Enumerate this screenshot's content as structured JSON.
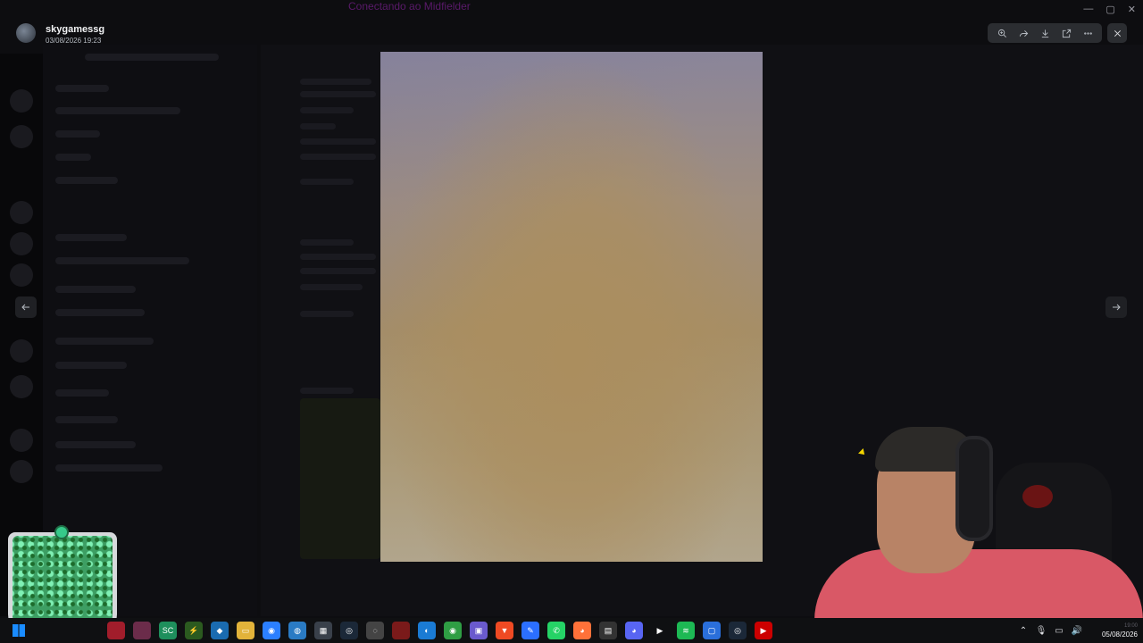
{
  "window": {
    "title": "Conectando ao Midfielder",
    "title_color": "#5a1a6a"
  },
  "viewer": {
    "username": "skygamessg",
    "date": "03/08/2026 19:23",
    "toolbar_icons": [
      "zoom-in-icon",
      "forward-icon",
      "download-icon",
      "open-external-icon",
      "more-icon"
    ],
    "close_icon": "close-icon",
    "prev_icon": "arrow-left-icon",
    "next_icon": "arrow-right-icon"
  },
  "taskbar": {
    "apps": [
      {
        "name": "media-app-icon",
        "color": "#a11d2b",
        "glyph": ""
      },
      {
        "name": "game-app-icon",
        "color": "#6b2c4a",
        "glyph": ""
      },
      {
        "name": "sc-app-icon",
        "color": "#1e8f5c",
        "glyph": "SC"
      },
      {
        "name": "nvidia-app-icon",
        "color": "#2b5a1f",
        "glyph": "⚡"
      },
      {
        "name": "vscode-app-icon",
        "color": "#1a6bb0",
        "glyph": "◆"
      },
      {
        "name": "explorer-app-icon",
        "color": "#e2b33a",
        "glyph": "▭"
      },
      {
        "name": "chat-app-icon",
        "color": "#2b7fff",
        "glyph": "◉"
      },
      {
        "name": "globe-app-icon",
        "color": "#2a7bc4",
        "glyph": "◍"
      },
      {
        "name": "store-app-icon",
        "color": "#39404a",
        "glyph": "▦"
      },
      {
        "name": "steam-app-icon",
        "color": "#1b2838",
        "glyph": "◎"
      },
      {
        "name": "chrome-alt-app-icon",
        "color": "#444",
        "glyph": "◌"
      },
      {
        "name": "red-app-icon",
        "color": "#7a1a1a",
        "glyph": ""
      },
      {
        "name": "edge-app-icon",
        "color": "#1a7bd4",
        "glyph": "◐"
      },
      {
        "name": "chrome-app-icon",
        "color": "#2f9e44",
        "glyph": "◉"
      },
      {
        "name": "grid-app-icon",
        "color": "#6a5acd",
        "glyph": "▣"
      },
      {
        "name": "brave-app-icon",
        "color": "#ef4a23",
        "glyph": "▼"
      },
      {
        "name": "pen-app-icon",
        "color": "#2b6fff",
        "glyph": "✎"
      },
      {
        "name": "whatsapp-app-icon",
        "color": "#25d366",
        "glyph": "✆"
      },
      {
        "name": "firefox-app-icon",
        "color": "#ff7139",
        "glyph": "◕"
      },
      {
        "name": "terminal-app-icon",
        "color": "#333",
        "glyph": "▤"
      },
      {
        "name": "discord-app-icon",
        "color": "#5865f2",
        "glyph": "◕"
      },
      {
        "name": "play-app-icon",
        "color": "#0f1012",
        "glyph": "▶"
      },
      {
        "name": "spotify-app-icon",
        "color": "#1db954",
        "glyph": "≋"
      },
      {
        "name": "app-blue-icon",
        "color": "#2a6fdb",
        "glyph": "▢"
      },
      {
        "name": "steam2-app-icon",
        "color": "#1b2838",
        "glyph": "◎"
      },
      {
        "name": "youtube-app-icon",
        "color": "#cc0000",
        "glyph": "▶"
      }
    ],
    "tray_icons": [
      "chevron-up-icon",
      "mic-icon",
      "network-icon",
      "volume-icon"
    ],
    "time": "19:00",
    "date": "05/08/2026"
  }
}
